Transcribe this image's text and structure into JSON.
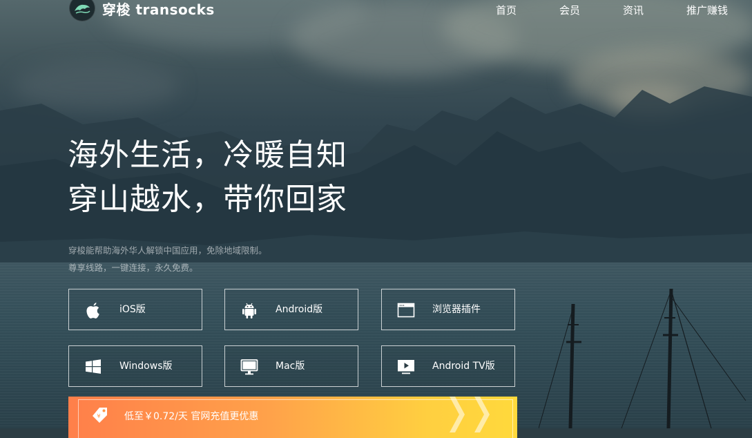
{
  "brand": {
    "name": "穿梭 transocks"
  },
  "nav": {
    "items": [
      "首页",
      "会员",
      "资讯",
      "推广赚钱"
    ]
  },
  "hero": {
    "title_line1": "海外生活，冷暖自知",
    "title_line2": "穿山越水，带你回家",
    "subtitle_line1": "穿梭能帮助海外华人解锁中国应用，免除地域限制。",
    "subtitle_line2": "尊享线路，一键连接，永久免费。"
  },
  "downloads": [
    {
      "label": "iOS版",
      "icon": "apple-icon"
    },
    {
      "label": "Android版",
      "icon": "android-icon"
    },
    {
      "label": "浏览器插件",
      "icon": "browser-window-icon"
    },
    {
      "label": "Windows版",
      "icon": "windows-icon"
    },
    {
      "label": "Mac版",
      "icon": "monitor-icon"
    },
    {
      "label": "Android TV版",
      "icon": "tv-play-icon"
    }
  ],
  "promo": {
    "text": "低至￥0.72/天 官网充值更优惠",
    "icon": "price-tag-icon"
  },
  "colors": {
    "promo_start": "#ff7f4a",
    "promo_end": "#ffd93c",
    "text": "#ffffff"
  }
}
